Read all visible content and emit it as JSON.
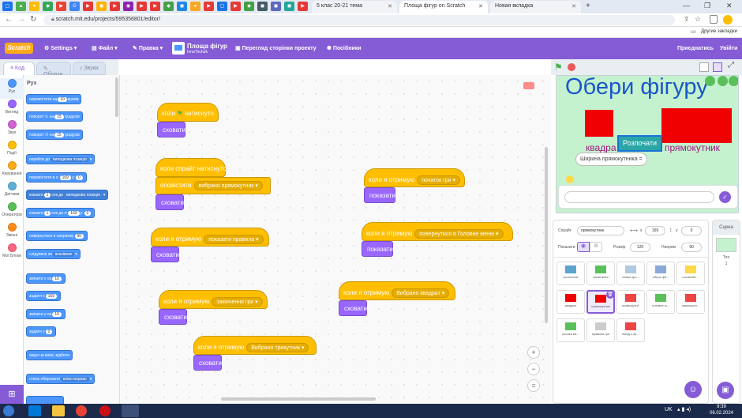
{
  "browser": {
    "tabs": [
      {
        "title": "5 клас 20-21 тема",
        "active": false
      },
      {
        "title": "Площа фігур on Scratch",
        "active": true
      },
      {
        "title": "Новая вкладка",
        "active": false
      }
    ],
    "url": "scratch.mit.edu/projects/595356801/editor/",
    "bookmarks_label": "Другие закладки"
  },
  "menu": {
    "settings": "Settings",
    "file": "Файл",
    "edit": "Правка",
    "project_title": "Площа фігур",
    "author": "InnaTrichuk",
    "project_page": "Перегляд сторінки проекту",
    "tutorials": "Посібники",
    "share": "Приєднатись",
    "login": "Увійти"
  },
  "editor_tabs": {
    "code": "Код",
    "costumes": "Образи",
    "sounds": "Звуки"
  },
  "categories": [
    {
      "label": "Рух",
      "color": "#4c97ff"
    },
    {
      "label": "Вигляд",
      "color": "#9966ff"
    },
    {
      "label": "Звук",
      "color": "#cf63cf"
    },
    {
      "label": "Події",
      "color": "#ffbf00"
    },
    {
      "label": "Керування",
      "color": "#ffab19"
    },
    {
      "label": "Датчики",
      "color": "#5cb1d6"
    },
    {
      "label": "Оператори",
      "color": "#59c059"
    },
    {
      "label": "Змінні",
      "color": "#ff8c1a"
    },
    {
      "label": "Мої Блоки",
      "color": "#ff6680"
    }
  ],
  "palette": {
    "heading": "Рух",
    "move": "перемістити на",
    "move_val": "10",
    "move_unit": "кроків",
    "turn_r": "поворот",
    "turn_r_on": "на",
    "turn_r_val": "15",
    "turn_unit": "градусів",
    "turn_l": "поворот",
    "turn_l_on": "на",
    "turn_l_val": "15",
    "goto": "перейти до",
    "goto_dd": "випадкова позиція",
    "goto_xy": "перемістити в x:",
    "goto_x": "169",
    "goto_y_lbl": "y:",
    "goto_y": "0",
    "glide": "ковзати",
    "glide_val": "1",
    "glide_mid": "сек до",
    "glide_dd": "випадкова позиція",
    "glide_xy": "ковзати",
    "glide_xy_val": "1",
    "glide_xy_mid": "сек до x:",
    "glide_xy_x": "169",
    "glide_xy_y_lbl": "y:",
    "glide_xy_y": "0",
    "point": "повернутися в напрямку",
    "point_val": "90",
    "point_to": "слідувати за",
    "point_to_dd": "вказівник",
    "change_x": "змінити x на",
    "change_x_val": "10",
    "set_x": "задати x",
    "set_x_val": "169",
    "change_y": "змінити y на",
    "change_y_val": "10",
    "set_y": "задати y",
    "set_y_val": "0",
    "bounce": "якщо на межі, відбити",
    "rotation": "стиль обертання",
    "rotation_dd": "вліво-вправо"
  },
  "scripts": [
    {
      "hat": "коли",
      "hat2": "натиснуто",
      "body": [
        "сховати"
      ]
    },
    {
      "hat": "коли спрайт натиснуто",
      "body": [],
      "event": {
        "label": "оповістити",
        "dd": "вибрано прямокутник"
      },
      "tail": "сховати"
    },
    {
      "hat": "коли я отримую",
      "dd": "показати правила",
      "body": [
        "сховати"
      ]
    },
    {
      "hat": "коли я отримую",
      "dd": "закінчення гри",
      "body": [
        "сховати"
      ]
    },
    {
      "hat": "коли я отримую",
      "dd": "Вибрано трикутник",
      "body": [
        "сховати"
      ]
    },
    {
      "hat": "коли я отримую",
      "dd": "початок гри",
      "body": [
        "показати"
      ]
    },
    {
      "hat": "коли я отримую",
      "dd": "повернутися в Головне меню",
      "body": [
        "показати"
      ]
    },
    {
      "hat": "коли я отримую",
      "dd": "Вибрано квадрат",
      "body": [
        "сховати"
      ]
    }
  ],
  "stage": {
    "title": "Обери фігуру",
    "start_btn": "Розпочати",
    "square_label": "квадра",
    "rect_label": "прямокутник",
    "question": "Ширина прямокутника ="
  },
  "sprite_info": {
    "sprite_lbl": "Спрайт",
    "sprite_name": "прямокутник",
    "x_lbl": "x",
    "x_val": "169",
    "y_lbl": "y",
    "y_val": "0",
    "show_lbl": "Показати",
    "size_lbl": "Розмір",
    "size_val": "120",
    "dir_lbl": "Напрям",
    "dir_val": "90"
  },
  "sprites": [
    {
      "name": "розпочати",
      "sel": false
    },
    {
      "name": "запитання",
      "sel": false
    },
    {
      "name": "назва про...",
      "sel": false
    },
    {
      "name": "обери фіг...",
      "sel": false
    },
    {
      "name": "головний ...",
      "sel": false
    },
    {
      "name": "квадрат",
      "sel": false
    },
    {
      "name": "прямокутник",
      "sel": true
    },
    {
      "name": "прямокутн2",
      "sel": false
    },
    {
      "name": "головне м...",
      "sel": false
    },
    {
      "name": "прямокутн...",
      "sel": false
    },
    {
      "name": "кнопка ви...",
      "sel": false
    },
    {
      "name": "правила гри",
      "sel": false
    },
    {
      "name": "вихід з пр...",
      "sel": false
    }
  ],
  "stage_pane": {
    "label": "Сцена",
    "backdrops_lbl": "Тло",
    "backdrops_val": "1"
  },
  "taskbar": {
    "lang": "UK",
    "time": "9:39",
    "date": "06.02.2024"
  }
}
